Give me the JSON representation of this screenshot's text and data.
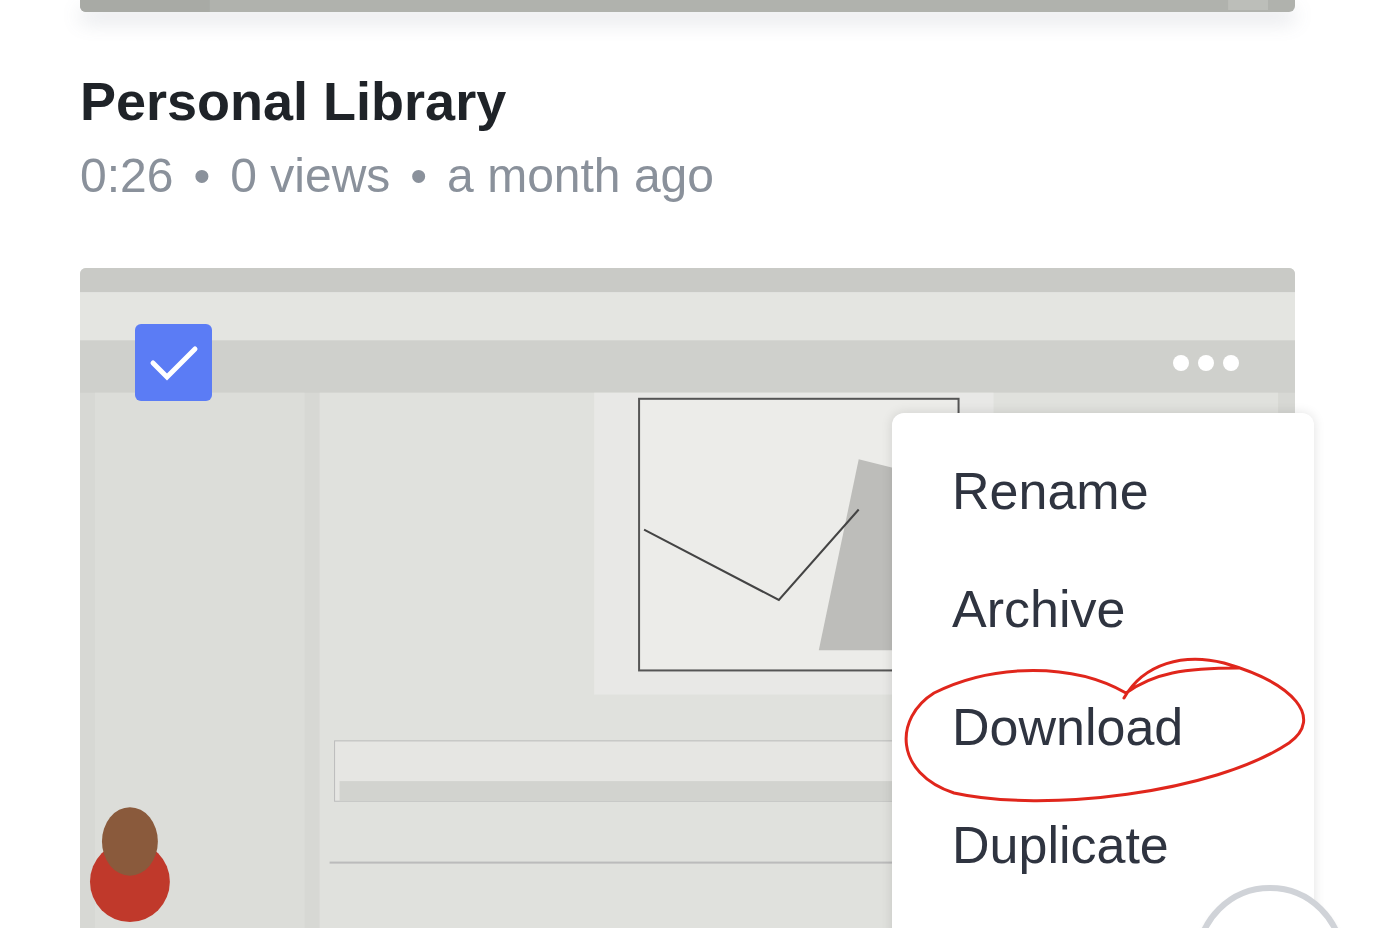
{
  "video": {
    "title": "Personal Library",
    "duration": "0:26",
    "views": "0 views",
    "age": "a month ago",
    "separator": "•",
    "checked": true
  },
  "menu": [
    {
      "label": "Rename",
      "circled": false
    },
    {
      "label": "Archive",
      "circled": false
    },
    {
      "label": "Download",
      "circled": true
    },
    {
      "label": "Duplicate",
      "circled": false
    }
  ]
}
